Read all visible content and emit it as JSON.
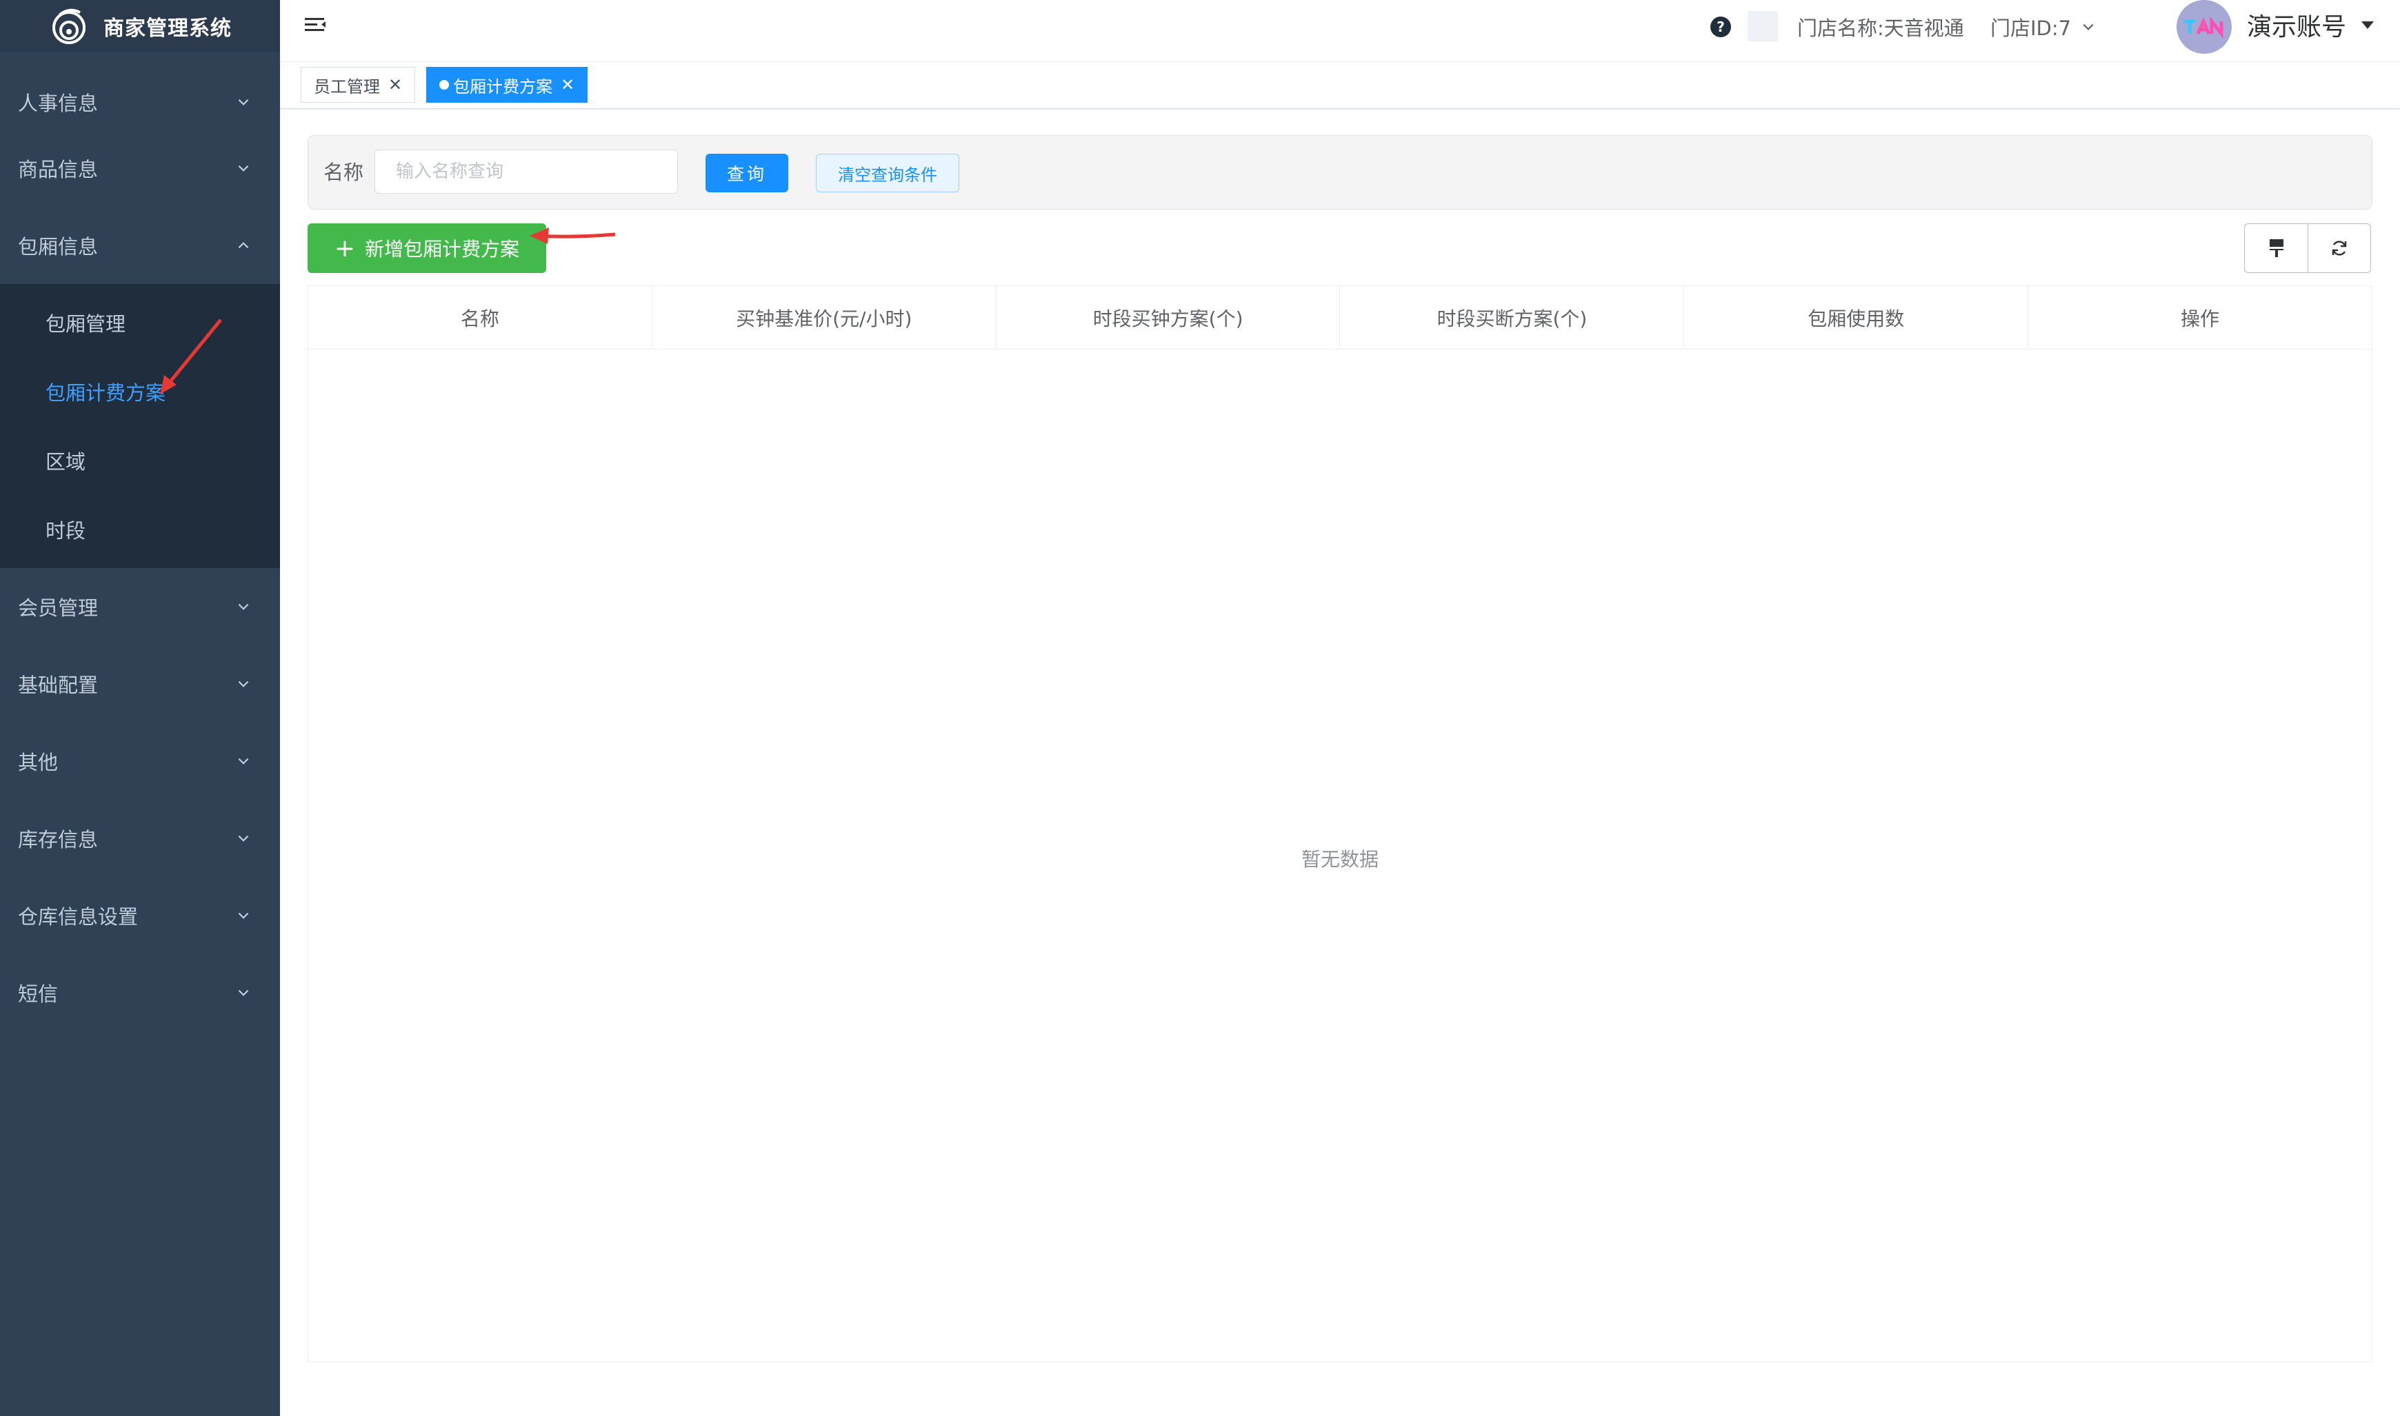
{
  "app": {
    "title": "商家管理系统"
  },
  "sidebar": {
    "menus": [
      {
        "label": "人事信息"
      },
      {
        "label": "商品信息"
      },
      {
        "label": "包厢信息"
      },
      {
        "label": "会员管理"
      },
      {
        "label": "基础配置"
      },
      {
        "label": "其他"
      },
      {
        "label": "库存信息"
      },
      {
        "label": "仓库信息设置"
      },
      {
        "label": "短信"
      }
    ],
    "submenu": [
      {
        "label": "包厢管理"
      },
      {
        "label": "包厢计费方案"
      },
      {
        "label": "区域"
      },
      {
        "label": "时段"
      }
    ],
    "active_sub": "包厢计费方案"
  },
  "header": {
    "store_name": "门店名称:天音视通",
    "store_id": "门店ID:7",
    "account": "演示账号",
    "help": "?"
  },
  "tags": [
    {
      "label": "员工管理"
    },
    {
      "label": "包厢计费方案"
    }
  ],
  "search": {
    "label": "名称",
    "placeholder": "输入名称查询",
    "query_btn": "查询",
    "clear_btn": "清空查询条件"
  },
  "actions": {
    "add_btn": "新增包厢计费方案"
  },
  "table": {
    "columns": [
      "名称",
      "买钟基准价(元/小时)",
      "时段买钟方案(个)",
      "时段买断方案(个)",
      "包厢使用数",
      "操作"
    ],
    "empty_text": "暂无数据"
  },
  "colors": {
    "sidebar_bg": "#304156",
    "primary": "#1890ff",
    "success": "#42b94a",
    "annotation": "#e53935"
  }
}
